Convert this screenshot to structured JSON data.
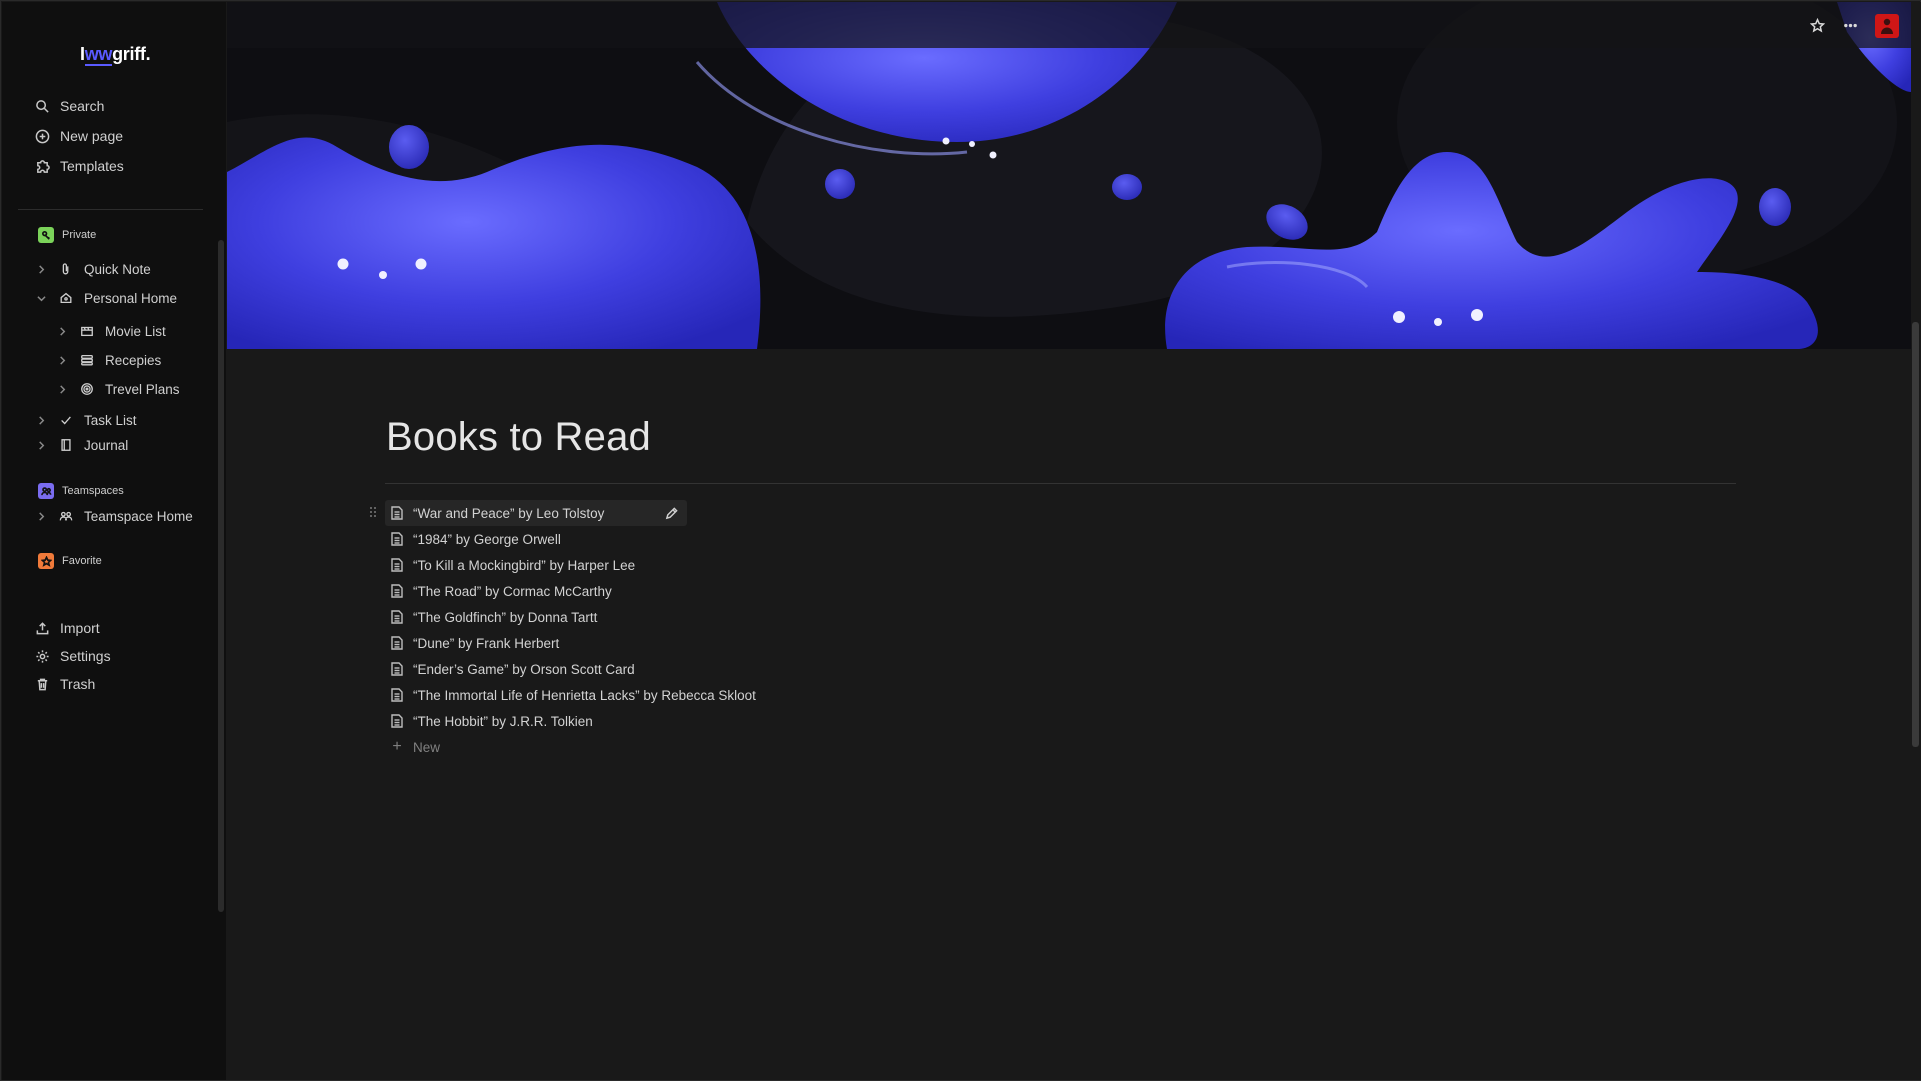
{
  "brand": {
    "prefix": "I",
    "mid": "ww",
    "suffix": "griff."
  },
  "sidebar": {
    "top_items": [
      {
        "label": "Search",
        "icon": "search-icon"
      },
      {
        "label": "New page",
        "icon": "plus-circle-icon"
      },
      {
        "label": "Templates",
        "icon": "puzzle-icon"
      }
    ],
    "sections": {
      "private": "Private",
      "teamspaces": "Teamspaces",
      "favorite": "Favorite"
    },
    "tree": [
      {
        "label": "Quick Note",
        "icon": "paperclip-icon",
        "expanded": false
      },
      {
        "label": "Personal Home",
        "icon": "home-icon",
        "expanded": true
      },
      {
        "label": "Movie List",
        "icon": "clapper-icon",
        "expanded": false
      },
      {
        "label": "Recepies",
        "icon": "database-icon",
        "expanded": false
      },
      {
        "label": "Trevel Plans",
        "icon": "target-icon",
        "expanded": false
      },
      {
        "label": "Task List",
        "icon": "check-icon",
        "expanded": false
      },
      {
        "label": "Journal",
        "icon": "notebook-icon",
        "expanded": false
      },
      {
        "label": "Teamspace Home",
        "icon": "people-icon",
        "expanded": false
      }
    ],
    "bottom_items": [
      {
        "label": "Import",
        "icon": "upload-icon"
      },
      {
        "label": "Settings",
        "icon": "gear-icon"
      },
      {
        "label": "Trash",
        "icon": "trash-icon"
      }
    ]
  },
  "page": {
    "title": "Books to Read",
    "books": [
      "“War and Peace” by Leo Tolstoy",
      "“1984” by George Orwell",
      "“To Kill a Mockingbird” by Harper Lee",
      "“The Road” by Cormac McCarthy",
      "“The Goldfinch” by Donna Tartt",
      "“Dune” by Frank Herbert",
      "“Ender’s Game” by Orson Scott Card",
      "“The Immortal Life of Henrietta Lacks” by Rebecca Skloot",
      "“The Hobbit” by J.R.R. Tolkien"
    ],
    "new_label": "New"
  },
  "colors": {
    "accent_blue": "#4b4bf0",
    "private_badge": "#7bd35a",
    "teamspaces_badge": "#7a6cf0",
    "favorite_badge": "#f07a3a",
    "avatar": "#d01616"
  }
}
